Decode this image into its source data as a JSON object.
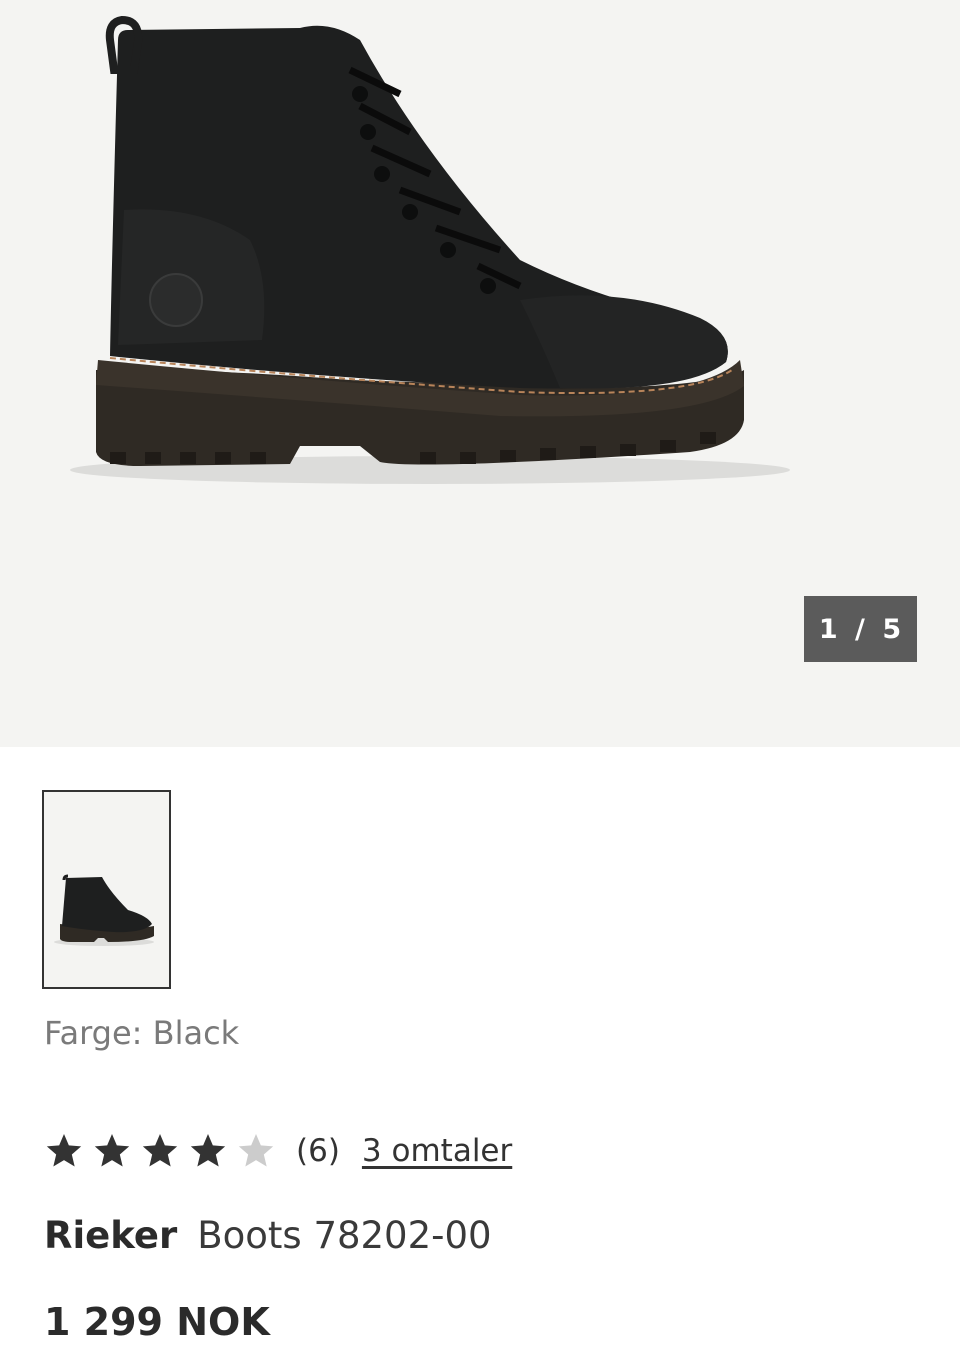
{
  "gallery": {
    "current_image": "1",
    "total_images": "5",
    "counter_text": "1 / 5",
    "image_alt": "boot-image"
  },
  "thumbnail": {
    "image_alt": "boot-thumbnail"
  },
  "product": {
    "color_label": "Farge: Black",
    "rating_value": 4,
    "rating_max": 5,
    "rating_count": "(6)",
    "reviews_link": "3 omtaler",
    "brand": "Rieker",
    "name": "Boots 78202-00",
    "price": "1 299 NOK"
  },
  "colors": {
    "gallery_bg": "#f4f4f2",
    "counter_bg": "#5b5b5b",
    "star_filled": "#333333",
    "star_empty": "#cccccc"
  }
}
